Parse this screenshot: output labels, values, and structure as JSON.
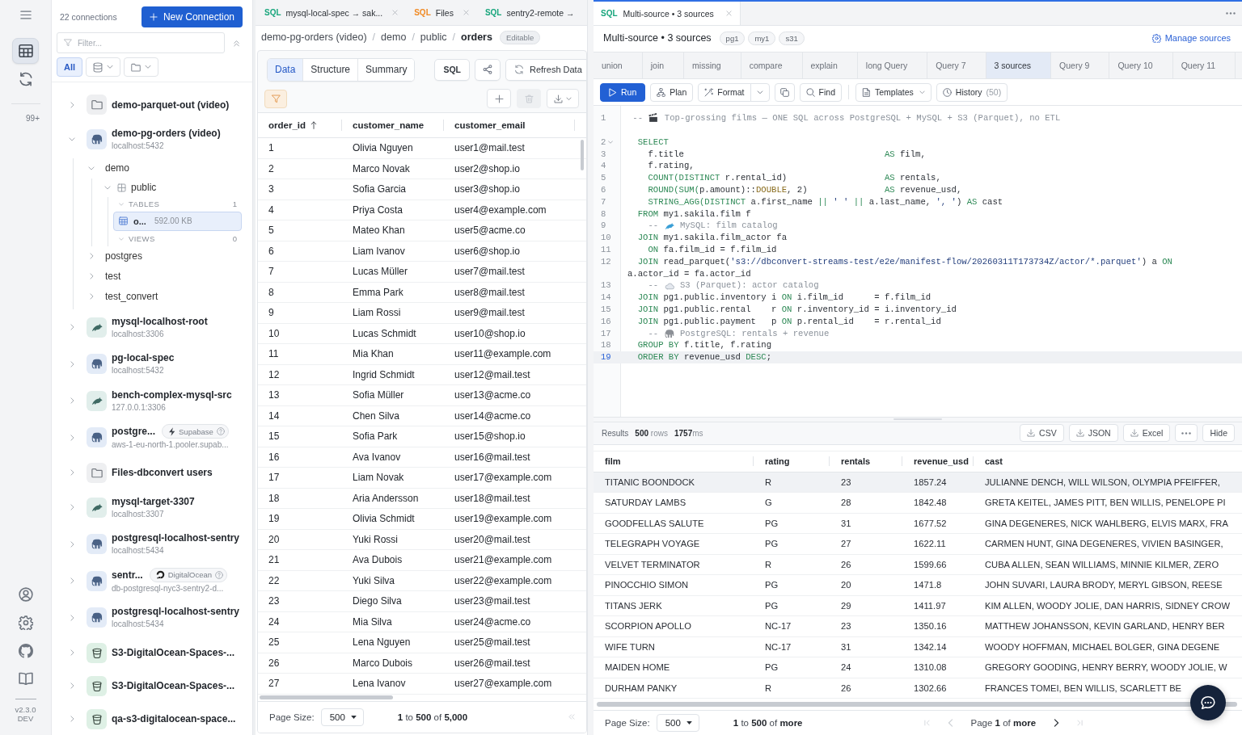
{
  "rail": {
    "nav": [
      {
        "kind": "tables",
        "selected": true
      },
      {
        "kind": "sync",
        "selected": false
      }
    ],
    "notifications": "99+",
    "footer_links": [
      {
        "kind": "account"
      },
      {
        "kind": "settings"
      },
      {
        "kind": "github"
      },
      {
        "kind": "docs"
      }
    ],
    "version": "v2.3.0",
    "channel": "DEV"
  },
  "connections_panel": {
    "count": "22 connections",
    "new_button": "New Connection",
    "filter": {
      "placeholder": "Filter..."
    },
    "type_filters": [
      {
        "kind": "text",
        "label": "All",
        "selected": true
      },
      {
        "kind": "database",
        "selected": false
      },
      {
        "kind": "folder",
        "selected": false
      }
    ],
    "connections": [
      {
        "name": "demo-parquet-out (video)",
        "kind": "files",
        "expanded": false
      },
      {
        "name": "demo-pg-orders (video)",
        "host": "localhost:5432",
        "kind": "postgres",
        "expanded": true,
        "children": [
          {
            "label": "demo",
            "expanded": true,
            "children": [
              {
                "label": "public",
                "expanded": true,
                "children": [
                  {
                    "label": "TABLES",
                    "count": "1",
                    "expanded": true,
                    "children": [
                      {
                        "label": "o...",
                        "size": "592.00 KB",
                        "selected": true
                      }
                    ]
                  },
                  {
                    "label": "VIEWS",
                    "count": "0",
                    "expanded": true
                  }
                ]
              }
            ]
          },
          {
            "label": "postgres",
            "expanded": false
          },
          {
            "label": "test",
            "expanded": false
          },
          {
            "label": "test_convert",
            "expanded": false
          }
        ]
      },
      {
        "name": "mysql-localhost-root",
        "host": "localhost:3306",
        "kind": "mysql",
        "expanded": false
      },
      {
        "name": "pg-local-spec",
        "host": "localhost:5432",
        "kind": "postgres",
        "expanded": false
      },
      {
        "name": "bench-complex-mysql-src",
        "host": "127.0.0.1:3306",
        "kind": "mysql",
        "expanded": false
      },
      {
        "name": "postgre...",
        "host": "aws-1-eu-north-1.pooler.supab...",
        "kind": "postgres",
        "expanded": false,
        "badge": {
          "kind": "supabase",
          "label": "Supabase"
        }
      },
      {
        "name": "Files-dbconvert users",
        "kind": "files",
        "expanded": false
      },
      {
        "name": "mysql-target-3307",
        "host": "localhost:3307",
        "kind": "mysql",
        "expanded": false
      },
      {
        "name": "postgresql-localhost-sentry",
        "host": "localhost:5434",
        "kind": "postgres",
        "expanded": false
      },
      {
        "name": "sentr...",
        "host": "db-postgresql-nyc3-sentry2-d...",
        "kind": "postgres",
        "expanded": false,
        "badge": {
          "kind": "digitalocean",
          "label": "DigitalOcean"
        }
      },
      {
        "name": "postgresql-localhost-sentry",
        "host": "localhost:5434",
        "kind": "postgres",
        "expanded": false
      },
      {
        "name": "S3-DigitalOcean-Spaces-...",
        "kind": "s3",
        "expanded": false
      },
      {
        "name": "S3-DigitalOcean-Spaces-...",
        "kind": "s3",
        "expanded": false
      },
      {
        "name": "qa-s3-digitalocean-space...",
        "kind": "s3",
        "expanded": false
      }
    ]
  },
  "table_view": {
    "tabs": [
      {
        "lang": "SQL",
        "label": "mysql-local-spec → sak...",
        "color": "#17a57c",
        "closable": true,
        "selected": false
      },
      {
        "lang": "SQL",
        "label": "Files",
        "color": "#f08a24",
        "closable": true,
        "selected": false
      },
      {
        "lang": "SQL",
        "label": "sentry2-remote →",
        "color": "#17a57c",
        "closable": false,
        "selected": false
      }
    ],
    "breadcrumb": {
      "separator": "/",
      "items": [
        {
          "label": "demo-pg-orders (video)",
          "current": false
        },
        {
          "label": "demo",
          "current": false
        },
        {
          "label": "public",
          "current": false
        },
        {
          "label": "orders",
          "current": true
        }
      ]
    },
    "badge": "Editable",
    "view_tabs": [
      {
        "label": "Data",
        "selected": true
      },
      {
        "label": "Structure",
        "selected": false
      },
      {
        "label": "Summary",
        "selected": false
      }
    ],
    "sql_button": "SQL",
    "refresh_button": "Refresh Data",
    "filter_active": true,
    "delete_disabled": true,
    "columns": [
      {
        "label": "order_id",
        "sorted": true
      },
      {
        "label": "customer_name",
        "sorted": false
      },
      {
        "label": "customer_email",
        "sorted": false
      }
    ],
    "rows": [
      [
        "1",
        "Olivia Nguyen",
        "user1@mail.test"
      ],
      [
        "2",
        "Marco Novak",
        "user2@shop.io"
      ],
      [
        "3",
        "Sofia Garcia",
        "user3@shop.io"
      ],
      [
        "4",
        "Priya Costa",
        "user4@example.com"
      ],
      [
        "5",
        "Mateo Khan",
        "user5@acme.co"
      ],
      [
        "6",
        "Liam Ivanov",
        "user6@shop.io"
      ],
      [
        "7",
        "Lucas Müller",
        "user7@mail.test"
      ],
      [
        "8",
        "Emma Park",
        "user8@mail.test"
      ],
      [
        "9",
        "Liam Rossi",
        "user9@mail.test"
      ],
      [
        "10",
        "Lucas Schmidt",
        "user10@shop.io"
      ],
      [
        "11",
        "Mia Khan",
        "user11@example.com"
      ],
      [
        "12",
        "Ingrid Schmidt",
        "user12@mail.test"
      ],
      [
        "13",
        "Sofia Müller",
        "user13@acme.co"
      ],
      [
        "14",
        "Chen Silva",
        "user14@acme.co"
      ],
      [
        "15",
        "Sofia Park",
        "user15@shop.io"
      ],
      [
        "16",
        "Ava Ivanov",
        "user16@mail.test"
      ],
      [
        "17",
        "Liam Novak",
        "user17@example.com"
      ],
      [
        "18",
        "Aria Andersson",
        "user18@mail.test"
      ],
      [
        "19",
        "Olivia Schmidt",
        "user19@example.com"
      ],
      [
        "20",
        "Yuki Rossi",
        "user20@mail.test"
      ],
      [
        "21",
        "Ava Dubois",
        "user21@example.com"
      ],
      [
        "22",
        "Yuki Silva",
        "user22@example.com"
      ],
      [
        "23",
        "Diego Silva",
        "user23@mail.test"
      ],
      [
        "24",
        "Mia Silva",
        "user24@acme.co"
      ],
      [
        "25",
        "Lena Nguyen",
        "user25@mail.test"
      ],
      [
        "26",
        "Marco Dubois",
        "user26@mail.test"
      ],
      [
        "27",
        "Lena Ivanov",
        "user27@example.com"
      ]
    ],
    "footer": {
      "page_size_label": "Page Size:",
      "page_size": "500",
      "range": "**1** to **500** of **5,000**",
      "first_page_disabled": true
    }
  },
  "query_pane": {
    "tabs": [
      {
        "lang": "SQL",
        "label": "Multi-source • 3 sources",
        "color": "#17a57c",
        "closable": true,
        "selected": true
      }
    ],
    "title": "Multi-source • 3 sources",
    "sources": [
      "pg1",
      "my1",
      "s31"
    ],
    "manage_link": "Manage sources",
    "query_tabs": [
      {
        "label": "union",
        "selected": false
      },
      {
        "label": "join",
        "selected": false
      },
      {
        "label": "missing",
        "selected": false
      },
      {
        "label": "compare",
        "selected": false
      },
      {
        "label": "explain",
        "selected": false
      },
      {
        "label": "long Query",
        "selected": false
      },
      {
        "label": "Query 7",
        "selected": false
      },
      {
        "label": "3 sources",
        "selected": true
      },
      {
        "label": "Query 9",
        "selected": false
      },
      {
        "label": "Query 10",
        "selected": false
      },
      {
        "label": "Query 11",
        "selected": false
      }
    ],
    "toolbar": [
      {
        "kind": "run",
        "label": "Run"
      },
      {
        "kind": "plan",
        "label": "Plan"
      },
      {
        "kind": "format",
        "label": "Format"
      },
      {
        "kind": "menu"
      },
      {
        "kind": "copy"
      },
      {
        "kind": "find",
        "label": "Find"
      },
      {
        "kind": "separator"
      },
      {
        "kind": "templates",
        "label": "Templates"
      },
      {
        "kind": "history",
        "label": "History",
        "count": "(50)"
      }
    ],
    "editor": {
      "lines": [
        {
          "number": "1",
          "current": false,
          "fold": false,
          "tokens": [
            {
              "kind": "comment",
              "text": " -- "
            },
            {
              "kind": "emoji"
            },
            {
              "kind": "comment",
              "text": " Top-grossing films — ONE SQL across PostgreSQL + MySQL + S3 (Parquet), no ETL"
            }
          ]
        },
        {
          "number": "2",
          "current": false,
          "fold": true,
          "tokens": [
            {
              "kind": "keyword",
              "text": "  SELECT"
            }
          ]
        },
        {
          "number": "3",
          "current": false,
          "fold": false,
          "tokens": [
            {
              "kind": "plain",
              "text": "    f.title                                       "
            },
            {
              "kind": "keyword",
              "text": "AS"
            },
            {
              "kind": "plain",
              "text": " film,"
            }
          ]
        },
        {
          "number": "4",
          "current": false,
          "fold": false,
          "tokens": [
            {
              "kind": "plain",
              "text": "    f.rating,"
            }
          ]
        },
        {
          "number": "5",
          "current": false,
          "fold": false,
          "tokens": [
            {
              "kind": "keyword",
              "text": "    COUNT(DISTINCT"
            },
            {
              "kind": "plain",
              "text": " r.rental_id)                   "
            },
            {
              "kind": "keyword",
              "text": "AS"
            },
            {
              "kind": "plain",
              "text": " rentals,"
            }
          ]
        },
        {
          "number": "6",
          "current": false,
          "fold": false,
          "tokens": [
            {
              "kind": "keyword",
              "text": "    ROUND(SUM("
            },
            {
              "kind": "plain",
              "text": "p.amount)::"
            },
            {
              "kind": "type",
              "text": "DOUBLE"
            },
            {
              "kind": "plain",
              "text": ", 2)               "
            },
            {
              "kind": "keyword",
              "text": "AS"
            },
            {
              "kind": "plain",
              "text": " revenue_usd,"
            }
          ]
        },
        {
          "number": "7",
          "current": false,
          "fold": false,
          "tokens": [
            {
              "kind": "keyword",
              "text": "    STRING_AGG(DISTINCT"
            },
            {
              "kind": "plain",
              "text": " a.first_name "
            },
            {
              "kind": "keyword",
              "text": "||"
            },
            {
              "kind": "string",
              "text": " ' ' "
            },
            {
              "kind": "keyword",
              "text": "||"
            },
            {
              "kind": "plain",
              "text": " a.last_name, "
            },
            {
              "kind": "string",
              "text": "', '"
            },
            {
              "kind": "plain",
              "text": ") "
            },
            {
              "kind": "keyword",
              "text": "AS"
            },
            {
              "kind": "plain",
              "text": " cast"
            }
          ]
        },
        {
          "number": "8",
          "current": false,
          "fold": false,
          "tokens": [
            {
              "kind": "keyword",
              "text": "  FROM"
            },
            {
              "kind": "plain",
              "text": " my1.sakila.film f"
            }
          ]
        },
        {
          "number": "9",
          "current": false,
          "fold": false,
          "tokens": [
            {
              "kind": "comment",
              "text": "    -- "
            },
            {
              "kind": "emoji"
            },
            {
              "kind": "comment",
              "text": " MySQL: film catalog"
            }
          ]
        },
        {
          "number": "10",
          "current": false,
          "fold": false,
          "tokens": [
            {
              "kind": "keyword",
              "text": "  JOIN"
            },
            {
              "kind": "plain",
              "text": " my1.sakila.film_actor fa"
            }
          ]
        },
        {
          "number": "11",
          "current": false,
          "fold": false,
          "tokens": [
            {
              "kind": "keyword",
              "text": "    ON"
            },
            {
              "kind": "plain",
              "text": " fa.film_id = f.film_id"
            }
          ]
        },
        {
          "number": "12",
          "current": false,
          "fold": false,
          "tokens": [
            {
              "kind": "keyword",
              "text": "  JOIN"
            },
            {
              "kind": "plain",
              "text": " read_parquet("
            },
            {
              "kind": "string",
              "text": "'s3://dbconvert-streams-test/e2e/manifest-flow/20260311T173734Z/actor/*.parquet'"
            },
            {
              "kind": "plain",
              "text": ") a "
            },
            {
              "kind": "keyword",
              "text": "ON"
            }
          ],
          "continuation": [
            {
              "kind": "plain",
              "text": "a.actor_id = fa.actor_id"
            }
          ]
        },
        {
          "number": "13",
          "current": false,
          "fold": false,
          "tokens": [
            {
              "kind": "comment",
              "text": "    -- "
            },
            {
              "kind": "emoji"
            },
            {
              "kind": "comment",
              "text": " S3 (Parquet): actor catalog"
            }
          ]
        },
        {
          "number": "14",
          "current": false,
          "fold": false,
          "tokens": [
            {
              "kind": "keyword",
              "text": "  JOIN"
            },
            {
              "kind": "plain",
              "text": " pg1.public.inventory i "
            },
            {
              "kind": "keyword",
              "text": "ON"
            },
            {
              "kind": "plain",
              "text": " i.film_id      = f.film_id"
            }
          ]
        },
        {
          "number": "15",
          "current": false,
          "fold": false,
          "tokens": [
            {
              "kind": "keyword",
              "text": "  JOIN"
            },
            {
              "kind": "plain",
              "text": " pg1.public.rental    r "
            },
            {
              "kind": "keyword",
              "text": "ON"
            },
            {
              "kind": "plain",
              "text": " r.inventory_id = i.inventory_id"
            }
          ]
        },
        {
          "number": "16",
          "current": false,
          "fold": false,
          "tokens": [
            {
              "kind": "keyword",
              "text": "  JOIN"
            },
            {
              "kind": "plain",
              "text": " pg1.public.payment   p "
            },
            {
              "kind": "keyword",
              "text": "ON"
            },
            {
              "kind": "plain",
              "text": " p.rental_id    = r.rental_id"
            }
          ]
        },
        {
          "number": "17",
          "current": false,
          "fold": false,
          "tokens": [
            {
              "kind": "comment",
              "text": "    -- "
            },
            {
              "kind": "emoji"
            },
            {
              "kind": "comment",
              "text": " PostgreSQL: rentals + revenue"
            }
          ]
        },
        {
          "number": "18",
          "current": false,
          "fold": false,
          "tokens": [
            {
              "kind": "keyword",
              "text": "  GROUP BY"
            },
            {
              "kind": "plain",
              "text": " f.title, f.rating"
            }
          ]
        },
        {
          "number": "19",
          "current": true,
          "fold": false,
          "tokens": [
            {
              "kind": "keyword",
              "text": "  ORDER BY"
            },
            {
              "kind": "plain",
              "text": " revenue_usd "
            },
            {
              "kind": "keyword",
              "text": "DESC"
            },
            {
              "kind": "plain",
              "text": ";"
            }
          ]
        }
      ]
    },
    "results": {
      "label": "Results",
      "row_count": "**500** rows",
      "time": "**1757**ms",
      "exports": [
        "CSV",
        "JSON",
        "Excel"
      ],
      "hide": "Hide",
      "columns": [
        "film",
        "rating",
        "rentals",
        "revenue_usd",
        "cast"
      ],
      "rows": [
        {
          "selected": true,
          "cells": [
            "TITANIC BOONDOCK",
            "R",
            "23",
            "1857.24",
            "JULIANNE DENCH, WILL WILSON, OLYMPIA PFEIFFER,"
          ]
        },
        {
          "selected": false,
          "cells": [
            "SATURDAY LAMBS",
            "G",
            "28",
            "1842.48",
            "GRETA KEITEL, JAMES PITT, BEN WILLIS, PENELOPE PI"
          ]
        },
        {
          "selected": false,
          "cells": [
            "GOODFELLAS SALUTE",
            "PG",
            "31",
            "1677.52",
            "GINA DEGENERES, NICK WAHLBERG, ELVIS MARX, FRA"
          ]
        },
        {
          "selected": false,
          "cells": [
            "TELEGRAPH VOYAGE",
            "PG",
            "27",
            "1622.11",
            "CARMEN HUNT, GINA DEGENERES, VIVIEN BASINGER,"
          ]
        },
        {
          "selected": false,
          "cells": [
            "VELVET TERMINATOR",
            "R",
            "26",
            "1599.66",
            "CUBA ALLEN, SEAN WILLIAMS, MINNIE KILMER, ZERO"
          ]
        },
        {
          "selected": false,
          "cells": [
            "PINOCCHIO SIMON",
            "PG",
            "20",
            "1471.8",
            "JOHN SUVARI, LAURA BRODY, MERYL GIBSON, REESE"
          ]
        },
        {
          "selected": false,
          "cells": [
            "TITANS JERK",
            "PG",
            "29",
            "1411.97",
            "KIM ALLEN, WOODY JOLIE, DAN HARRIS, SIDNEY CROW"
          ]
        },
        {
          "selected": false,
          "cells": [
            "SCORPION APOLLO",
            "NC-17",
            "23",
            "1350.16",
            "MATTHEW JOHANSSON, KEVIN GARLAND, HENRY BER"
          ]
        },
        {
          "selected": false,
          "cells": [
            "WIFE TURN",
            "NC-17",
            "31",
            "1342.14",
            "WOODY HOFFMAN, MICHAEL BOLGER, GINA DEGENE"
          ]
        },
        {
          "selected": false,
          "cells": [
            "MAIDEN HOME",
            "PG",
            "24",
            "1310.08",
            "GREGORY GOODING, HENRY BERRY, WOODY JOLIE, W"
          ]
        },
        {
          "selected": false,
          "cells": [
            "DURHAM PANKY",
            "R",
            "26",
            "1302.66",
            "FRANCES TOMEI, BEN WILLIS, SCARLETT BE"
          ]
        }
      ],
      "footer": {
        "page_size_label": "Page Size:",
        "page_size": "500",
        "range": "**1** to **500** of **more**",
        "pager": {
          "back": [
            {
              "kind": "first",
              "disabled": true
            },
            {
              "kind": "previous",
              "disabled": true
            }
          ],
          "label": "Page **1** of **more**",
          "forward": [
            {
              "kind": "next",
              "disabled": false
            },
            {
              "kind": "last",
              "disabled": true
            }
          ]
        }
      }
    }
  }
}
